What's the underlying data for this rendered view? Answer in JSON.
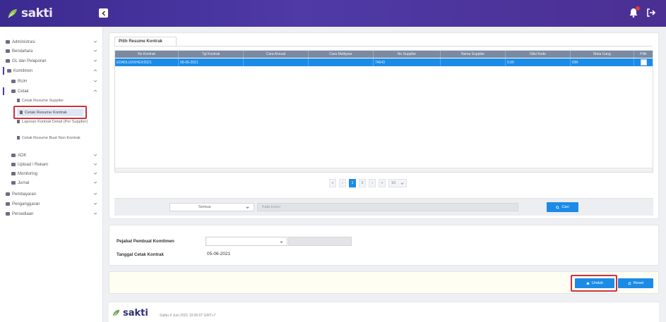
{
  "app": {
    "logo_text": "sakti",
    "colors": {
      "header_start": "#3b2a8f",
      "header_end": "#4b2f93",
      "primary": "#1b8be8",
      "highlight": "#d0303b",
      "grid_header": "#7a8aa3"
    }
  },
  "header": {
    "collapse_icon": "chevron-left-icon",
    "notification_icon": "bell-icon",
    "logout_icon": "logout-icon"
  },
  "sidebar": {
    "items": [
      {
        "label": "Administrasi"
      },
      {
        "label": "Bendahara"
      },
      {
        "label": "GL dan Pelaporan"
      },
      {
        "label": "Komitmen"
      },
      {
        "label": "RUH"
      },
      {
        "label": "Cetak"
      },
      {
        "label": "Cetak Resume Supplier"
      },
      {
        "label": "Cetak Resume Kontrak"
      },
      {
        "label": "Laporan Kontrak Detail (Per Supplier)"
      },
      {
        "label": "Cetak Resume Buat Non Kontrak"
      },
      {
        "label": "ADK"
      },
      {
        "label": "Upload / Rekam"
      },
      {
        "label": "Monitoring"
      },
      {
        "label": "Jurnal"
      },
      {
        "label": "Pembayaran"
      },
      {
        "label": "Penganggaran"
      },
      {
        "label": "Persediaan"
      }
    ]
  },
  "main": {
    "tab_label": "Pilih Resume Kontrak",
    "columns": [
      "No Kontrak",
      "Tgl Kontrak",
      "Cara Annual",
      "Cara Multiyear",
      "No Supplier",
      "Nama Supplier",
      "Nilai Kode",
      "Mata Uang",
      "Pilih"
    ],
    "rows": [
      [
        "EDADLUXXHEX/2021",
        "06-06-2021",
        "",
        "",
        "74643",
        "",
        "0.00",
        "IDR",
        ""
      ]
    ],
    "pager": {
      "first": "«",
      "prev": "‹",
      "pages": [
        "1",
        "2"
      ],
      "next": "›",
      "last": "»",
      "page_size": "10"
    },
    "filter": {
      "select_value": "Semua",
      "search_placeholder": "Kata kunci",
      "search_button": "Cari"
    }
  },
  "form": {
    "ppk_label": "Pejabat Pembuat Komitmen",
    "date_label": "Tanggal Cetak Kontrak",
    "date_value": "05-06-2021"
  },
  "actions": {
    "print_label": "Unduh",
    "reset_label": "Reset"
  },
  "footer": {
    "logo_text": "sakti",
    "info": "Sabtu 6 Juni 2021 10:06:07 GMT+7"
  }
}
